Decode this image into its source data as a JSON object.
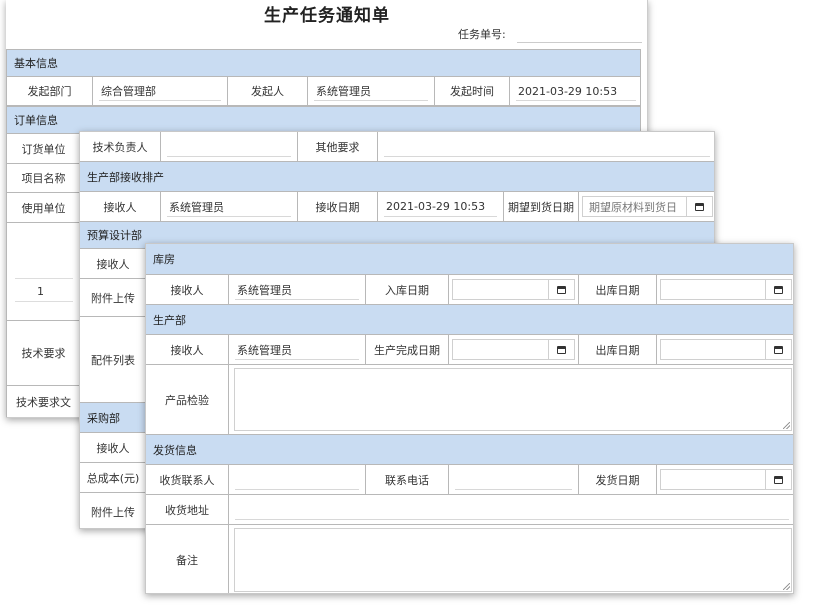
{
  "doc": {
    "title": "生产任务通知单",
    "task_no_label": "任务单号:"
  },
  "basic": {
    "section": "基本信息",
    "dept_label": "发起部门",
    "dept_value": "综合管理部",
    "initiator_label": "发起人",
    "initiator_value": "系统管理员",
    "time_label": "发起时间",
    "time_value": "2021-03-29 10:53"
  },
  "order": {
    "section": "订单信息",
    "buyer_label": "订货单位",
    "project_label": "项目名称",
    "user_label": "使用单位",
    "row_index": "1",
    "tech_req_label": "技术要求",
    "tech_doc_label": "技术要求文"
  },
  "tech": {
    "owner_label": "技术负责人",
    "other_label": "其他要求"
  },
  "prod_schedule": {
    "section": "生产部接收排产",
    "receiver_label": "接收人",
    "receiver_value": "系统管理员",
    "recv_date_label": "接收日期",
    "recv_date_value": "2021-03-29 10:53",
    "expect_date_label": "期望到货日期",
    "expect_placeholder": "期望原材料到货日"
  },
  "budget": {
    "section": "预算设计部",
    "receiver_label": "接收人",
    "attach_label": "附件上传",
    "parts_label": "配件列表"
  },
  "purchase": {
    "section": "采购部",
    "receiver_label": "接收人",
    "cost_label": "总成本(元)",
    "attach_label": "附件上传"
  },
  "warehouse": {
    "section": "库房",
    "receiver_label": "接收人",
    "receiver_value": "系统管理员",
    "in_date_label": "入库日期",
    "out_date_label": "出库日期"
  },
  "production": {
    "section": "生产部",
    "receiver_label": "接收人",
    "receiver_value": "系统管理员",
    "finish_label": "生产完成日期",
    "out_date_label": "出库日期",
    "inspect_label": "产品检验"
  },
  "shipping": {
    "section": "发货信息",
    "contact_label": "收货联系人",
    "phone_label": "联系电话",
    "ship_date_label": "发货日期",
    "address_label": "收货地址",
    "remark_label": "备注"
  },
  "icons": {
    "calendar": "calendar-icon",
    "resize": "resize-grip-icon"
  },
  "colors": {
    "section_bg": "#c9dcf2",
    "border": "#b8b8b8"
  }
}
